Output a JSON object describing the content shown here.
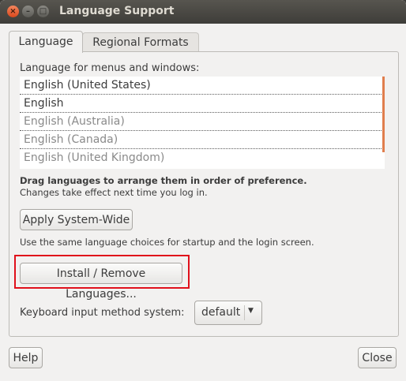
{
  "window": {
    "title": "Language Support",
    "controls": {
      "close": "×",
      "minimize": "–",
      "maximize": "□"
    }
  },
  "tabs": [
    {
      "label": "Language",
      "active": true
    },
    {
      "label": "Regional Formats",
      "active": false
    }
  ],
  "language": {
    "list_label": "Language for menus and windows:",
    "languages": [
      {
        "name": "English (United States)",
        "enabled": true
      },
      {
        "name": "English",
        "enabled": true
      },
      {
        "name": "English (Australia)",
        "enabled": false
      },
      {
        "name": "English (Canada)",
        "enabled": false
      },
      {
        "name": "English (United Kingdom)",
        "enabled": false
      }
    ],
    "drag_hint": "Drag languages to arrange them in order of preference.",
    "effect_hint": "Changes take effect next time you log in.",
    "apply_button": "Apply System-Wide",
    "apply_hint": "Use the same language choices for startup and the login screen.",
    "install_button": "Install / Remove Languages...",
    "keyboard_label": "Keyboard input method system:",
    "keyboard_value": "default"
  },
  "footer": {
    "help_button": "Help",
    "close_button": "Close"
  },
  "colors": {
    "highlight": "#e0101b",
    "scroll_accent": "#e07e4d",
    "titlebar": "#3e3d39"
  }
}
